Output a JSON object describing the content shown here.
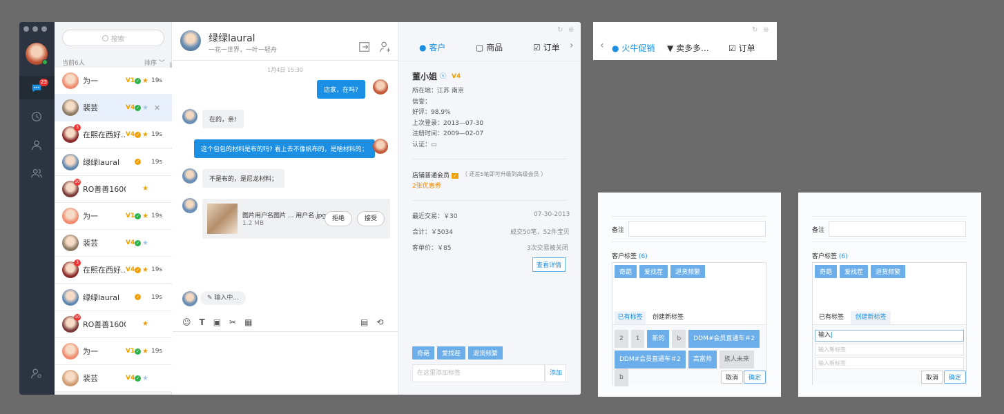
{
  "search": {
    "placeholder": "搜索"
  },
  "contacts": {
    "count_label": "当前6人",
    "sort_label": "排序",
    "items": [
      {
        "name": "为一",
        "vip": "V1",
        "time": "19s",
        "badge": "",
        "av": "#f08a6e",
        "check": "#2db34a",
        "star": "#f0a000"
      },
      {
        "name": "裴芸",
        "vip": "V4",
        "time": "",
        "badge": "",
        "av": "#8c7a64",
        "check": "#2db34a",
        "star": "#a8c4e3"
      },
      {
        "name": "在熙在西好...",
        "vip": "V4",
        "time": "19s",
        "badge": "3",
        "av": "#8a2a2a",
        "check": "#f0a000",
        "star": "#f0a000"
      },
      {
        "name": "绿绿laural",
        "vip": "",
        "time": "19s",
        "badge": "",
        "av": "#5d86b0",
        "check": "#f0a000",
        "star": ""
      },
      {
        "name": "RO善善1600",
        "vip": "",
        "time": "",
        "badge": "10",
        "av": "#7a3a3a",
        "check": "",
        "star": "#f0a000"
      },
      {
        "name": "为一",
        "vip": "V1",
        "time": "19s",
        "badge": "",
        "av": "#f08a6e",
        "check": "#2db34a",
        "star": "#f0a000"
      },
      {
        "name": "裴芸",
        "vip": "V4",
        "time": "",
        "badge": "",
        "av": "#8c7a64",
        "check": "#2db34a",
        "star": "#a8c4e3"
      },
      {
        "name": "在熙在西好...",
        "vip": "V4",
        "time": "19s",
        "badge": "3",
        "av": "#8a2a2a",
        "check": "#f0a000",
        "star": "#f0a000"
      },
      {
        "name": "绿绿laural",
        "vip": "",
        "time": "19s",
        "badge": "",
        "av": "#5d86b0",
        "check": "#f0a000",
        "star": ""
      },
      {
        "name": "RO善善1600",
        "vip": "",
        "time": "",
        "badge": "10",
        "av": "#7a3a3a",
        "check": "",
        "star": "#f0a000"
      },
      {
        "name": "为一",
        "vip": "V1",
        "time": "19s",
        "badge": "",
        "av": "#f08a6e",
        "check": "#2db34a",
        "star": "#f0a000"
      },
      {
        "name": "裴芸",
        "vip": "V4",
        "time": "",
        "badge": "",
        "av": "#d09a70",
        "check": "#2db34a",
        "star": "#a8c4e3"
      }
    ]
  },
  "nav": {
    "unread": "23"
  },
  "chat": {
    "title": "绿绿laural",
    "subtitle": "一花一世界，一叶一轻舟",
    "date": "1月4日  15:30",
    "msg1": "店家，在吗?",
    "msg2": "在的，亲!",
    "msg3": "这个包包的材料是布的吗? 看上去不像帆布的，是啥材料的；",
    "msg4": "不是布的，是尼龙材料；",
    "file_name": "图片用户名图片 ... 用户名.jpg",
    "file_size": "1.2 MB",
    "reject": "拒绝",
    "accept": "接受",
    "typing": "输入中..."
  },
  "info": {
    "tabs": [
      "客户",
      "商品",
      "订单"
    ],
    "name": "董小姐",
    "vip": "V4",
    "location": "所在地：江苏 南京",
    "credit": "信誉：",
    "rating": "好评：98.9%",
    "last_login": "上次登录：2013—07-30",
    "reg_time": "注册时间：2009—02-07",
    "cert": "认证：",
    "member": "店铺普通会员",
    "member_note": "（ 还差5笔即可升级到高级会员 ）",
    "coupons": "2张优惠券",
    "last_trade": "最近交易：￥30",
    "last_trade_date": "07-30-2013",
    "total": "合计：￥5034",
    "deals": "成交50笔，52件宝贝",
    "avg": "客单价：￥85",
    "closed": "3次交易被关闭",
    "detail_btn": "查看详情",
    "tags": [
      "奇葩",
      "爱找茬",
      "退货频繁"
    ],
    "tag_placeholder": "在这里添加标签",
    "add_btn": "添加"
  },
  "mini": {
    "tabs": [
      "火牛促销",
      "卖多多...",
      "订单"
    ]
  },
  "panel_a": {
    "note_label": "备注",
    "tags_label": "客户标签",
    "tags_count": "(6)",
    "tags": [
      "奇葩",
      "爱找茬",
      "退货频繁"
    ],
    "tab1": "已有标签",
    "tab2": "创建新标签",
    "existing": [
      "2",
      "1",
      "新的",
      "b",
      "DDM#会员直通车＃2",
      "DDM#会员直通车＃2",
      "高富帅",
      "族人未来",
      "b"
    ],
    "cancel": "取消",
    "ok": "确定"
  },
  "panel_b": {
    "note_label": "备注",
    "tags_label": "客户标签",
    "tags_count": "(6)",
    "tags": [
      "奇葩",
      "爱找茬",
      "退货频繁"
    ],
    "tab1": "已有标签",
    "tab2": "创建新标签",
    "input1": "输入",
    "ph2": "输入新标签",
    "ph3": "输入新标签",
    "cancel": "取消",
    "ok": "确定"
  }
}
